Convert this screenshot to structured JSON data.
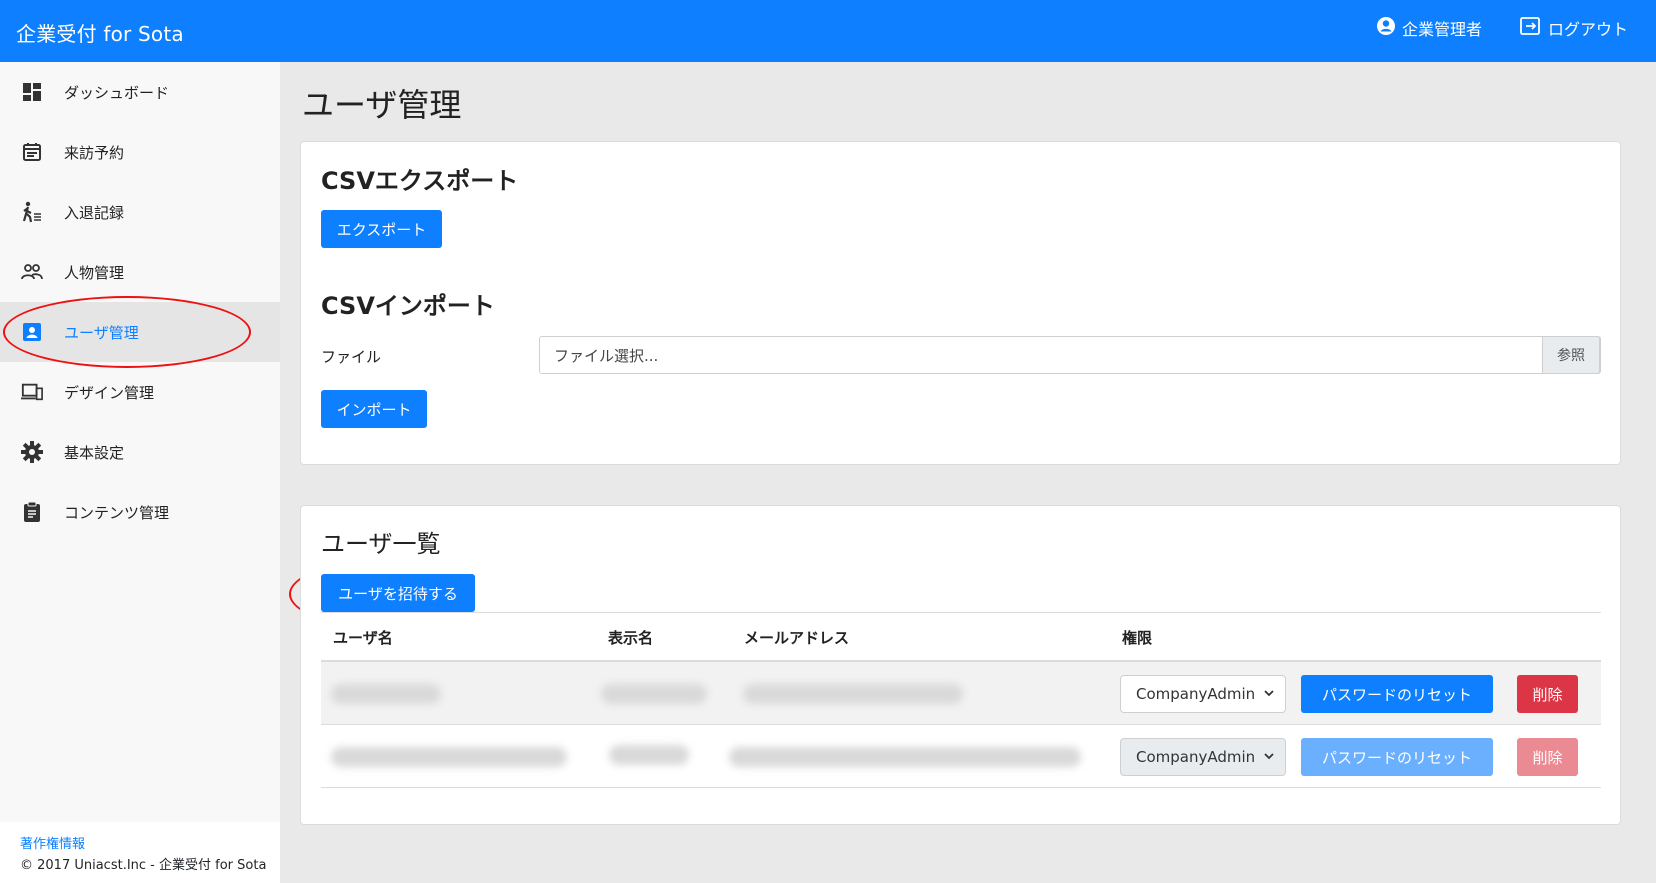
{
  "header": {
    "brand": "企業受付 for Sota",
    "user_label": "企業管理者",
    "logout_label": "ログアウト"
  },
  "sidebar": {
    "items": [
      {
        "label": "ダッシュボード",
        "icon": "dashboard-icon"
      },
      {
        "label": "来訪予約",
        "icon": "calendar-icon"
      },
      {
        "label": "入退記録",
        "icon": "walk-log-icon"
      },
      {
        "label": "人物管理",
        "icon": "people-icon"
      },
      {
        "label": "ユーザ管理",
        "icon": "user-badge-icon",
        "active": true
      },
      {
        "label": "デザイン管理",
        "icon": "devices-icon"
      },
      {
        "label": "基本設定",
        "icon": "gear-icon"
      },
      {
        "label": "コンテンツ管理",
        "icon": "clipboard-icon"
      }
    ],
    "footer_link": "著作権情報",
    "footer_copyright": "© 2017 Uniacst.Inc - 企業受付 for Sota"
  },
  "main": {
    "title": "ユーザ管理",
    "csv_export": {
      "heading": "CSVエクスポート",
      "button": "エクスポート"
    },
    "csv_import": {
      "heading": "CSVインポート",
      "file_label": "ファイル",
      "file_placeholder": "ファイル選択...",
      "browse_button": "参照",
      "button": "インポート"
    },
    "users": {
      "heading": "ユーザ一覧",
      "invite_button": "ユーザを招待する",
      "columns": [
        "ユーザ名",
        "表示名",
        "メールアドレス",
        "権限"
      ],
      "rows": [
        {
          "role": "CompanyAdmin",
          "reset_button": "パスワードのリセット",
          "delete_button": "削除",
          "enabled": true
        },
        {
          "role": "CompanyAdmin",
          "reset_button": "パスワードのリセット",
          "delete_button": "削除",
          "enabled": false
        }
      ]
    }
  },
  "colors": {
    "primary": "#0d7fff",
    "danger": "#dc3545",
    "annotation": "#ee1111"
  }
}
